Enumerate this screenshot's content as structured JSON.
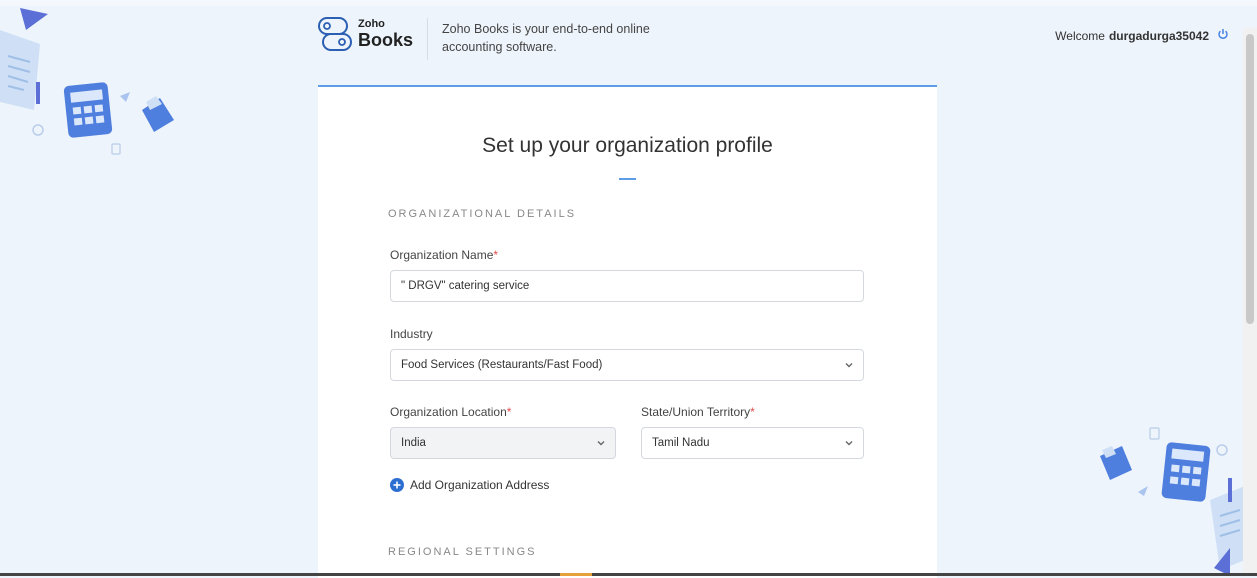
{
  "header": {
    "logo_top": "Zoho",
    "logo_bottom": "Books",
    "tagline": "Zoho Books is your end-to-end online accounting software.",
    "welcome_prefix": "Welcome",
    "username": "durgadurga35042"
  },
  "form": {
    "title": "Set up your organization profile",
    "org_section": "ORGANIZATIONAL DETAILS",
    "org_name_label": "Organization Name",
    "org_name_value": "\" DRGV\" catering service",
    "industry_label": "Industry",
    "industry_value": "Food Services (Restaurants/Fast Food)",
    "location_label": "Organization Location",
    "location_value": "India",
    "state_label": "State/Union Territory",
    "state_value": "Tamil Nadu",
    "add_address": "Add Organization Address",
    "regional_section": "REGIONAL SETTINGS",
    "required_marker": "*"
  },
  "icons": [
    "zoho-books-logo-icon",
    "power-icon",
    "chevron-down-icon",
    "add-circle-icon",
    "calculator-icon",
    "document-icon"
  ],
  "colors": {
    "accent": "#5d9ce6",
    "required": "#e54b4b",
    "background": "#eef4fb",
    "add_icon": "#2d6fd0"
  }
}
